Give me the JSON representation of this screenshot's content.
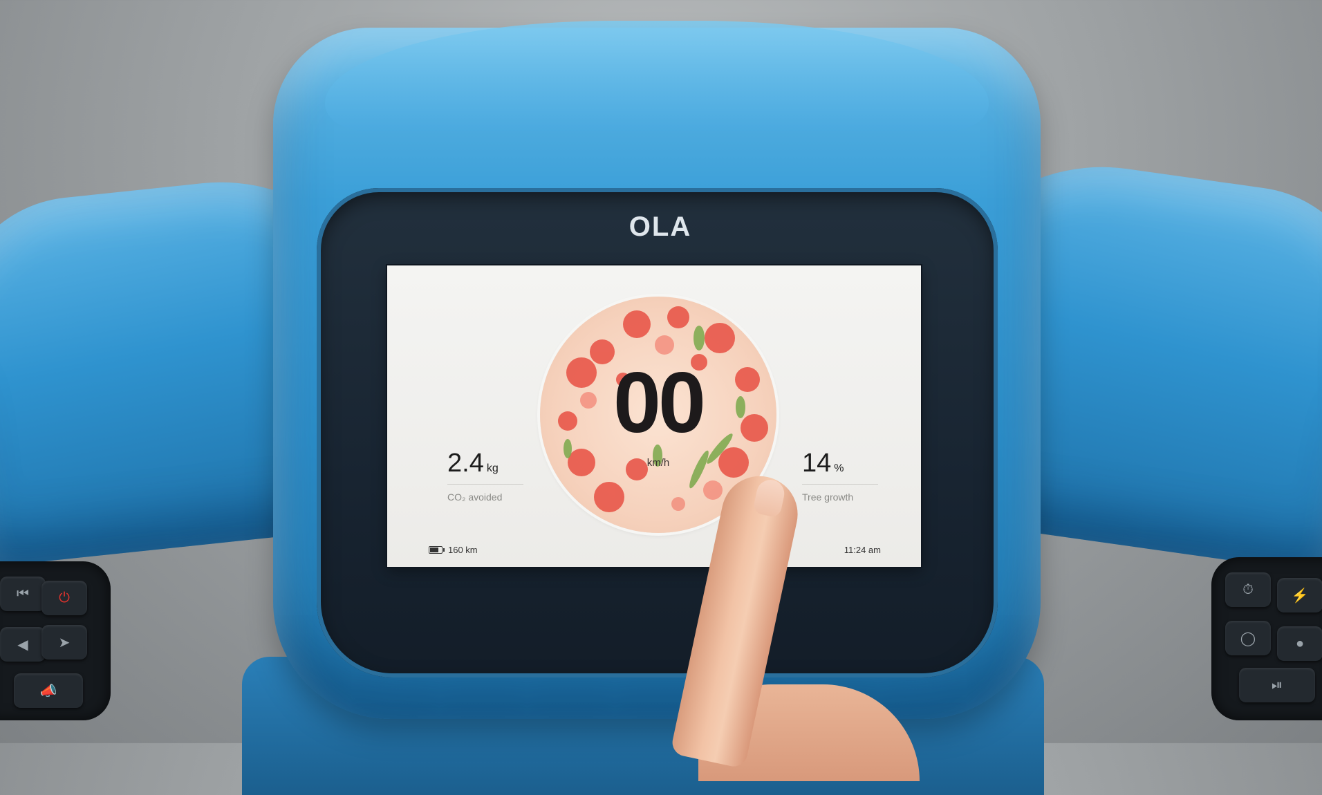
{
  "device": {
    "brand_logo": "OLA"
  },
  "display": {
    "speed": "00",
    "speed_unit": "km/h",
    "left_stat": {
      "value": "2.4",
      "unit": "kg",
      "label": "CO₂ avoided"
    },
    "right_stat": {
      "value": "14",
      "unit": "%",
      "label": "Tree growth"
    },
    "range": "160 km",
    "time": "11:24 am"
  },
  "icons": {
    "battery": "battery-icon",
    "power": "power-icon",
    "left_arrow": "arrow-left-icon",
    "right_arrow": "arrow-right-icon",
    "horn": "horn-icon",
    "speed_mode": "speedometer-icon",
    "boost": "lightning-icon",
    "record": "circle-icon",
    "play_pause": "play-pause-icon"
  },
  "colors": {
    "body_blue": "#2f93cf",
    "bezel": "#182431",
    "screen_bg": "#f2f2f0",
    "dial_bg": "#f6d2bd",
    "flower_red": "#e8574a",
    "leaf_green": "#7aa84a",
    "power_red": "#e2332d"
  }
}
